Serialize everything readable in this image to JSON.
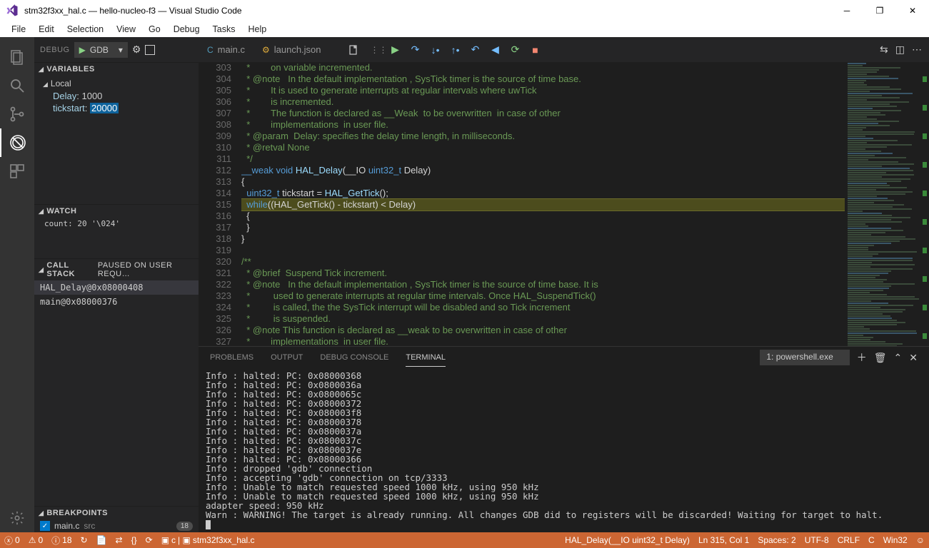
{
  "window": {
    "title": "stm32f3xx_hal.c — hello-nucleo-f3 — Visual Studio Code"
  },
  "menu": {
    "items": [
      "File",
      "Edit",
      "Selection",
      "View",
      "Go",
      "Debug",
      "Tasks",
      "Help"
    ]
  },
  "sidebar": {
    "debugLabel": "DEBUG",
    "dropdown": "GDB",
    "variables": {
      "title": "VARIABLES",
      "scope": "Local",
      "vars": [
        {
          "name": "Delay",
          "val": "1000"
        },
        {
          "name": "tickstart",
          "val": "20000",
          "selected": true
        }
      ]
    },
    "watch": {
      "title": "WATCH",
      "items": [
        "count: 20 '\\024'"
      ]
    },
    "callStack": {
      "title": "CALL STACK",
      "extra": "PAUSED ON USER REQU…",
      "items": [
        {
          "label": "HAL_Delay@0x08000408",
          "selected": true
        },
        {
          "label": "main@0x08000376"
        }
      ]
    },
    "breakpoints": {
      "title": "BREAKPOINTS",
      "items": [
        {
          "label": "main.c",
          "tag": "src",
          "badge": "18"
        }
      ]
    }
  },
  "tabs": [
    {
      "label": "main.c",
      "type": "c"
    },
    {
      "label": "launch.json",
      "type": "j"
    }
  ],
  "editor": {
    "startLine": 303,
    "currentLine": 315,
    "lines": [
      "  *        on variable incremented.",
      "  * @note   In the default implementation , SysTick timer is the source of time base.",
      "  *        It is used to generate interrupts at regular intervals where uwTick",
      "  *        is incremented.",
      "  *        The function is declared as __Weak  to be overwritten  in case of other",
      "  *        implementations  in user file.",
      "  * @param  Delay: specifies the delay time length, in milliseconds.",
      "  * @retval None",
      "  */",
      "",
      "{",
      "  ",
      "  ",
      "  {",
      "  }",
      "}",
      "",
      "/**",
      "  * @brief  Suspend Tick increment.",
      "  * @note   In the default implementation , SysTick timer is the source of time base. It is",
      "  *         used to generate interrupts at regular time intervals. Once HAL_SuspendTick()",
      "  *         is called, the the SysTick interrupt will be disabled and so Tick increment",
      "  *         is suspended.",
      "  * @note This function is declared as __weak to be overwritten in case of other",
      "  *        implementations  in user file."
    ],
    "funcDecl": {
      "kw": "__weak",
      "type": "void",
      "fn": "HAL_Delay",
      "args": "(__IO ",
      "argtype": "uint32_t",
      "argname": " Delay)"
    },
    "line314": {
      "type": "uint32_t",
      "var": " tickstart = ",
      "fn": "HAL_GetTick",
      "rest": "();"
    },
    "line315": {
      "kw": "while",
      "rest": "((HAL_GetTick() - tickstart) < Delay)"
    }
  },
  "panel": {
    "tabs": [
      "PROBLEMS",
      "OUTPUT",
      "DEBUG CONSOLE",
      "TERMINAL"
    ],
    "active": 3,
    "terminalSelect": "1: powershell.exe",
    "terminalLines": [
      "Info : halted: PC: 0x08000368",
      "Info : halted: PC: 0x0800036a",
      "Info : halted: PC: 0x0800065c",
      "Info : halted: PC: 0x08000372",
      "Info : halted: PC: 0x080003f8",
      "Info : halted: PC: 0x08000378",
      "Info : halted: PC: 0x0800037a",
      "Info : halted: PC: 0x0800037c",
      "Info : halted: PC: 0x0800037e",
      "Info : halted: PC: 0x08000366",
      "Info : dropped 'gdb' connection",
      "Info : accepting 'gdb' connection on tcp/3333",
      "Info : Unable to match requested speed 1000 kHz, using 950 kHz",
      "Info : Unable to match requested speed 1000 kHz, using 950 kHz",
      "adapter speed: 950 kHz",
      "Warn : WARNING! The target is already running. All changes GDB did to registers will be discarded! Waiting for target to halt."
    ]
  },
  "status": {
    "errors": "0",
    "warnings": "0",
    "info": "18",
    "breadcrumb1": "c",
    "breadcrumb2": "stm32f3xx_hal.c",
    "funcSig": "HAL_Delay(__IO uint32_t Delay)",
    "pos": "Ln 315, Col 1",
    "spaces": "Spaces: 2",
    "enc": "UTF-8",
    "eol": "CRLF",
    "lang": "C",
    "target": "Win32"
  }
}
